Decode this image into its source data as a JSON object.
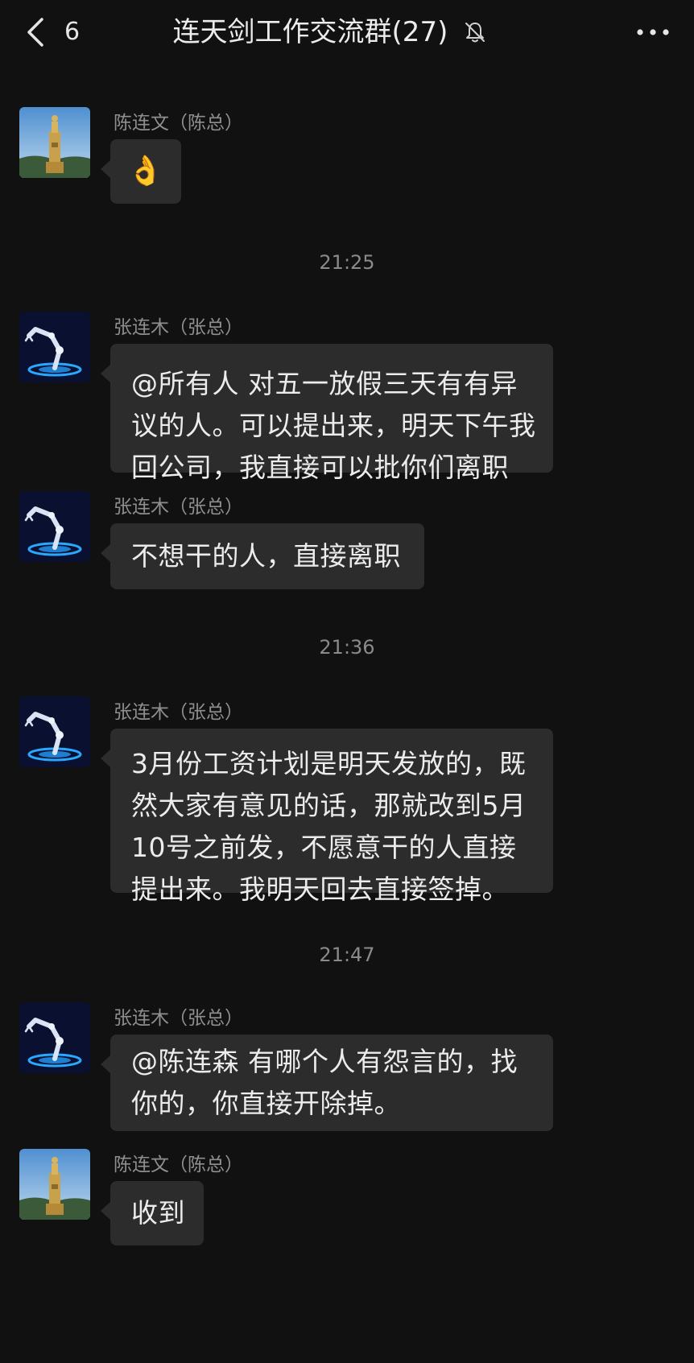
{
  "header": {
    "back_count": "6",
    "title": "连天剑工作交流群(27)",
    "muted": true
  },
  "senders": {
    "chen": "陈连文（陈总）",
    "zhang": "张连木（张总）"
  },
  "timestamps": [
    "21:25",
    "21:36",
    "21:47"
  ],
  "messages": [
    {
      "sender": "陈连文（陈总）",
      "avatar": "tower-avatar",
      "emoji": "👌"
    },
    {
      "sender": "张连木（张总）",
      "avatar": "robot-arm-avatar",
      "lines": [
        "@所有人  对五一放假三天有有异",
        "议的人。可以提出来，明天下午我",
        "回公司，我直接可以批你们离职"
      ]
    },
    {
      "sender": "张连木（张总）",
      "avatar": "robot-arm-avatar",
      "lines": [
        "不想干的人，直接离职"
      ]
    },
    {
      "sender": "张连木（张总）",
      "avatar": "robot-arm-avatar",
      "lines": [
        "3月份工资计划是明天发放的，既",
        "然大家有意见的话，那就改到5月",
        "10号之前发，不愿意干的人直接",
        "提出来。我明天回去直接签掉。"
      ]
    },
    {
      "sender": "张连木（张总）",
      "avatar": "robot-arm-avatar",
      "lines": [
        "@陈连森  有哪个人有怨言的，找",
        "你的，你直接开除掉。"
      ]
    },
    {
      "sender": "陈连文（陈总）",
      "avatar": "tower-avatar",
      "lines": [
        "收到"
      ]
    }
  ],
  "colors": {
    "background": "#111111",
    "bubble": "#2c2c2c",
    "text": "#ececec",
    "muted_text": "#8a8a8a"
  }
}
